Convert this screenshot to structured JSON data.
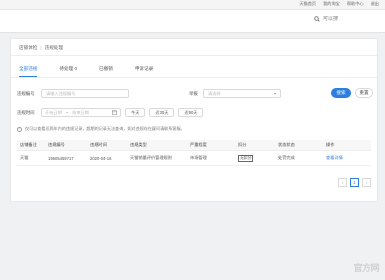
{
  "topbar": {
    "links": [
      "天猫首页",
      "我的淘宝",
      "帮助中心",
      "退出"
    ]
  },
  "header": {
    "search": {
      "placeholder": "可以搜"
    }
  },
  "breadcrumb": {
    "items": [
      "店铺体检",
      "违规处理"
    ]
  },
  "tabs": [
    {
      "label": "全部违规",
      "active": true
    },
    {
      "label": "待处理 0",
      "active": false
    },
    {
      "label": "已撤销",
      "active": false
    },
    {
      "label": "申诉记录",
      "active": false
    }
  ],
  "filters": {
    "id_label": "违规编号",
    "id_placeholder": "请输入违规编号",
    "type_label": "举报",
    "type_value": "请选择",
    "time_label": "违规时间",
    "start_placeholder": "开始日期",
    "to": "~",
    "end_placeholder": "结束日期",
    "quick": [
      "今天",
      "近30天",
      "近90天"
    ],
    "search_button": "搜索",
    "reset_button": "重置"
  },
  "notice": "仅可以查看近两年内的违规记录，超期的记录无法查询，如对违规存在疑问请联系客服。",
  "table": {
    "columns": [
      "店铺备注",
      "违规编号",
      "违规时间",
      "违规类型",
      "严重程度",
      "扣分",
      "状态状态",
      "操作"
    ],
    "rows": [
      [
        "天猫",
        "19505459717",
        "2020-04-16",
        "天猫销量评价管理规则",
        "市场管理",
        "无扣分",
        "处罚完成",
        "查看详情"
      ]
    ]
  },
  "pagination": {
    "prev": "‹",
    "current": "1",
    "next": "›"
  },
  "watermark": "官方网"
}
